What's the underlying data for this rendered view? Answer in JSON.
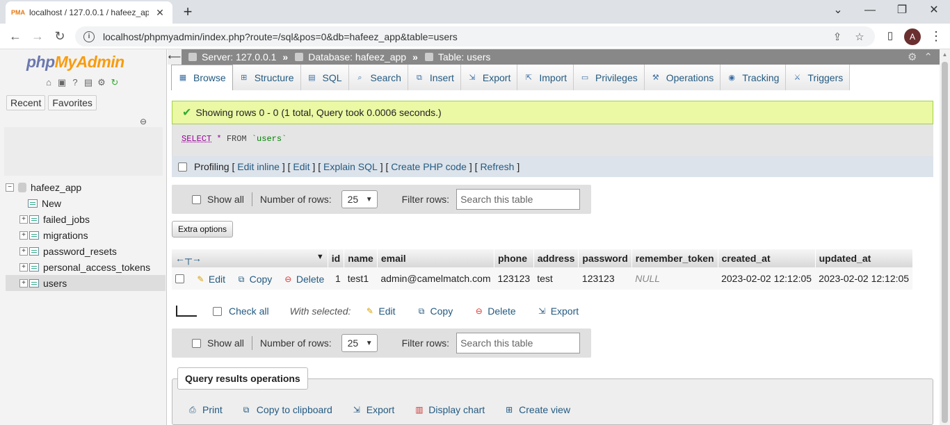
{
  "browser": {
    "tab_title": "localhost / 127.0.0.1 / hafeez_app",
    "url": "localhost/phpmyadmin/index.php?route=/sql&pos=0&db=hafeez_app&table=users",
    "avatar_letter": "A"
  },
  "sidebar": {
    "logo_php": "php",
    "logo_myadmin": "MyAdmin",
    "recent": "Recent",
    "favorites": "Favorites",
    "database": "hafeez_app",
    "new_label": "New",
    "tables": [
      "failed_jobs",
      "migrations",
      "password_resets",
      "personal_access_tokens",
      "users"
    ]
  },
  "breadcrumb": {
    "server": "Server: 127.0.0.1",
    "database": "Database: hafeez_app",
    "table": "Table: users"
  },
  "tabs": [
    "Browse",
    "Structure",
    "SQL",
    "Search",
    "Insert",
    "Export",
    "Import",
    "Privileges",
    "Operations",
    "Tracking",
    "Triggers"
  ],
  "success_message": "Showing rows 0 - 0 (1 total, Query took 0.0006 seconds.)",
  "sql": {
    "select": "SELECT",
    "star": "*",
    "from": "FROM",
    "table": "`users`"
  },
  "profiling": {
    "label": "Profiling",
    "links": [
      "Edit inline",
      "Edit",
      "Explain SQL",
      "Create PHP code",
      "Refresh"
    ]
  },
  "navigation": {
    "show_all": "Show all",
    "number_of_rows": "Number of rows:",
    "rows_value": "25",
    "filter_rows": "Filter rows:",
    "search_placeholder": "Search this table"
  },
  "extra_options": "Extra options",
  "table": {
    "columns": [
      "id",
      "name",
      "email",
      "phone",
      "address",
      "password",
      "remember_token",
      "created_at",
      "updated_at"
    ],
    "actions": {
      "edit": "Edit",
      "copy": "Copy",
      "delete": "Delete"
    },
    "rows": [
      {
        "id": "1",
        "name": "test1",
        "email": "admin@camelmatch.com",
        "phone": "123123",
        "address": "test",
        "password": "123123",
        "remember_token": "NULL",
        "created_at": "2023-02-02 12:12:05",
        "updated_at": "2023-02-02 12:12:05"
      }
    ]
  },
  "bulk": {
    "check_all": "Check all",
    "with_selected": "With selected:",
    "edit": "Edit",
    "copy": "Copy",
    "delete": "Delete",
    "export": "Export"
  },
  "query_results_operations": {
    "title": "Query results operations",
    "links": [
      "Print",
      "Copy to clipboard",
      "Export",
      "Display chart",
      "Create view"
    ]
  }
}
